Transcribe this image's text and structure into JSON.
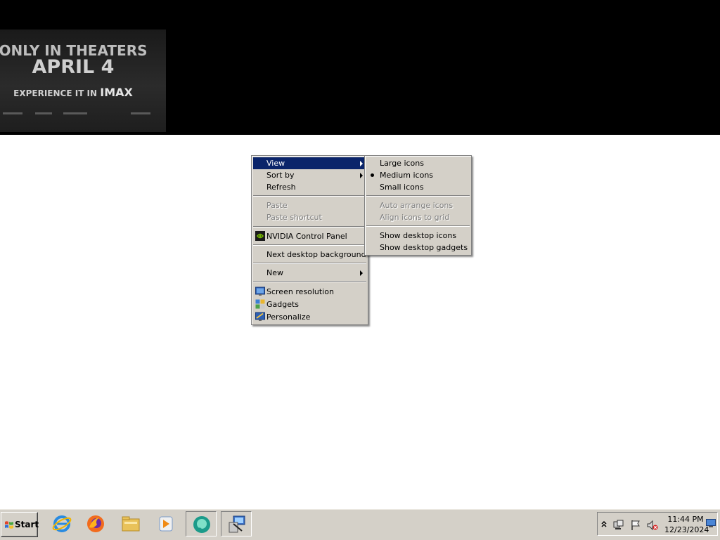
{
  "wallpaper": {
    "line1": "ONLY IN THEATERS",
    "line2": "APRIL 4",
    "line3_prefix": "EXPERIENCE IT IN ",
    "line3_brand": "IMAX"
  },
  "context_menu": {
    "items": [
      {
        "label": "View",
        "submenu": true,
        "highlighted": true
      },
      {
        "label": "Sort by",
        "submenu": true
      },
      {
        "label": "Refresh"
      },
      {
        "label": "Paste",
        "disabled": true
      },
      {
        "label": "Paste shortcut",
        "disabled": true
      },
      {
        "label": "NVIDIA Control Panel",
        "icon": "nvidia-icon"
      },
      {
        "label": "Next desktop background"
      },
      {
        "label": "New",
        "submenu": true
      },
      {
        "label": "Screen resolution",
        "icon": "screen-resolution-icon"
      },
      {
        "label": "Gadgets",
        "icon": "gadgets-icon"
      },
      {
        "label": "Personalize",
        "icon": "personalize-icon"
      }
    ]
  },
  "view_submenu": {
    "items": [
      {
        "label": "Large icons"
      },
      {
        "label": "Medium icons",
        "selected": true
      },
      {
        "label": "Small icons"
      },
      {
        "label": "Auto arrange icons",
        "disabled": true
      },
      {
        "label": "Align icons to grid",
        "disabled": true
      },
      {
        "label": "Show desktop icons"
      },
      {
        "label": "Show desktop gadgets"
      }
    ]
  },
  "taskbar": {
    "start_label": "Start",
    "pinned": [
      {
        "name": "internet-explorer-icon"
      },
      {
        "name": "firefox-icon"
      },
      {
        "name": "file-explorer-icon"
      },
      {
        "name": "media-player-icon"
      },
      {
        "name": "chat-app-icon",
        "active": true
      },
      {
        "name": "network-app-icon",
        "active": true
      }
    ],
    "tray_icons": [
      "show-hidden-icons-chevron",
      "network-icon",
      "action-center-flag-icon",
      "volume-muted-icon",
      "show-desktop-icon"
    ],
    "clock": {
      "time": "11:44 PM",
      "date": "12/23/2024"
    }
  },
  "colors": {
    "highlight": "#0a246a",
    "menu_face": "#d4d0c8",
    "desktop": "#ffffff"
  }
}
